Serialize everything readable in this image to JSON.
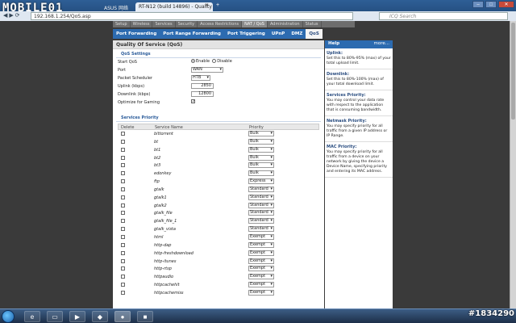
{
  "browser": {
    "logo": "MOBILE01",
    "tab1_label": "ASUS 网络论坛",
    "tab2_label": "RT-N12 (build 14896) - Quality of S...",
    "tab_close": "✕",
    "tab_add": "+",
    "url": "192.168.1.254/QoS.asp",
    "search_placeholder": "ICQ Search",
    "nav": "◀ ▶ ⟳"
  },
  "top_tabs": [
    "Setup",
    "Wireless",
    "Services",
    "Security",
    "Access Restrictions",
    "NAT / QoS",
    "Administration",
    "Status"
  ],
  "sub_tabs": [
    "Port Forwarding",
    "Port Range Forwarding",
    "Port Triggering",
    "UPnP",
    "DMZ",
    "QoS"
  ],
  "main": {
    "title": "Quality Of Service (QoS)",
    "qos_settings_title": "QoS Settings",
    "start_qos_label": "Start QoS",
    "enable_label": "Enable",
    "disable_label": "Disable",
    "port_label": "Port",
    "port_value": "WAN",
    "scheduler_label": "Packet Scheduler",
    "scheduler_value": "HTB",
    "uplink_label": "Uplink (kbps)",
    "uplink_value": "2850",
    "downlink_label": "Downlink (kbps)",
    "downlink_value": "12800",
    "gaming_label": "Optimize for Gaming",
    "gaming_check": "✓",
    "services_title": "Services Priority",
    "col_delete": "Delete",
    "col_service": "Service Name",
    "col_priority": "Priority",
    "services": [
      {
        "name": "bittorrent",
        "priority": "Bulk"
      },
      {
        "name": "bt",
        "priority": "Bulk"
      },
      {
        "name": "bt1",
        "priority": "Bulk"
      },
      {
        "name": "bt2",
        "priority": "Bulk"
      },
      {
        "name": "bt3",
        "priority": "Bulk"
      },
      {
        "name": "edonkey",
        "priority": "Bulk"
      },
      {
        "name": "ftp",
        "priority": "Express"
      },
      {
        "name": "gtalk",
        "priority": "Standard"
      },
      {
        "name": "gtalk1",
        "priority": "Standard"
      },
      {
        "name": "gtalk2",
        "priority": "Standard"
      },
      {
        "name": "gtalk_file",
        "priority": "Standard"
      },
      {
        "name": "gtalk_file_1",
        "priority": "Standard"
      },
      {
        "name": "gtalk_vista",
        "priority": "Standard"
      },
      {
        "name": "html",
        "priority": "Exempt"
      },
      {
        "name": "http-dap",
        "priority": "Exempt"
      },
      {
        "name": "http-freshdownload",
        "priority": "Exempt"
      },
      {
        "name": "http-itunes",
        "priority": "Exempt"
      },
      {
        "name": "http-rtsp",
        "priority": "Exempt"
      },
      {
        "name": "httpaudio",
        "priority": "Exempt"
      },
      {
        "name": "httpcachehit",
        "priority": "Exempt"
      },
      {
        "name": "httpcachemiss",
        "priority": "Exempt"
      }
    ]
  },
  "help": {
    "title": "Help",
    "more": "more...",
    "blocks": [
      {
        "heading": "Uplink:",
        "text": "Set this to 80%-95% (max) of your total upload limit."
      },
      {
        "heading": "Downlink:",
        "text": "Set this to 80%-100% (max) of your total download limit."
      },
      {
        "heading": "Services Priority:",
        "text": "You may control your data rate with respect to the application that is consuming bandwidth."
      },
      {
        "heading": "Netmask Priority:",
        "text": "You may specify priority for all traffic from a given IP address or IP Range."
      },
      {
        "heading": "MAC Priority:",
        "text": "You may specify priority for all traffic from a device on your network by giving the device a Device Name, specifying priority and entering its MAC address."
      }
    ]
  },
  "watermark": "#1834290",
  "colors": {
    "accent": "#2c6bb0",
    "window_frame": "#1f4572"
  }
}
